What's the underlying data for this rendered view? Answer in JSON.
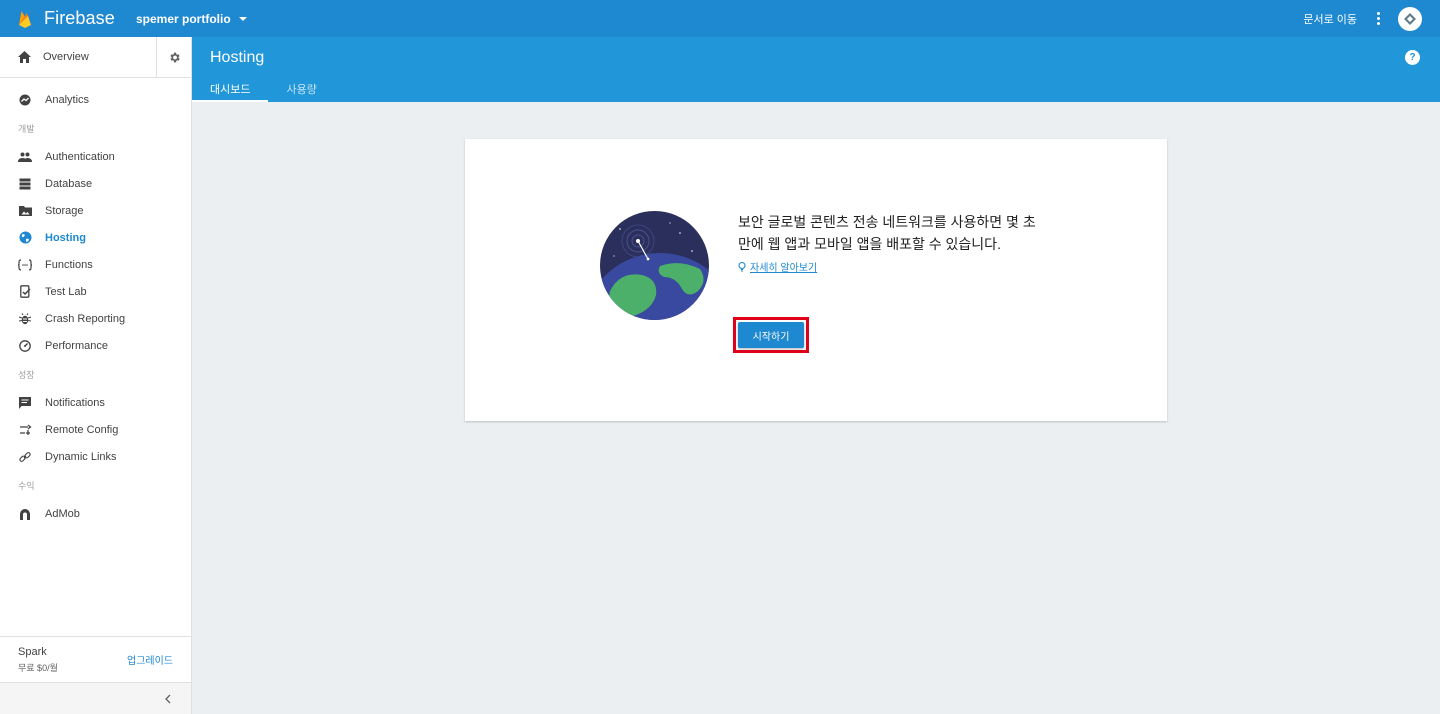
{
  "topbar": {
    "brand": "Firebase",
    "project": "spemer portfolio",
    "docs_link": "문서로 이동"
  },
  "sidebar": {
    "overview": "Overview",
    "items": [
      {
        "label": "Analytics",
        "icon": "analytics-icon"
      },
      {
        "section": "개발"
      },
      {
        "label": "Authentication",
        "icon": "people-icon"
      },
      {
        "label": "Database",
        "icon": "database-icon"
      },
      {
        "label": "Storage",
        "icon": "folder-image-icon"
      },
      {
        "label": "Hosting",
        "icon": "globe-icon",
        "active": true
      },
      {
        "label": "Functions",
        "icon": "functions-icon"
      },
      {
        "label": "Test Lab",
        "icon": "test-lab-icon"
      },
      {
        "label": "Crash Reporting",
        "icon": "bug-icon"
      },
      {
        "label": "Performance",
        "icon": "speedometer-icon"
      },
      {
        "section": "성장"
      },
      {
        "label": "Notifications",
        "icon": "message-icon"
      },
      {
        "label": "Remote Config",
        "icon": "remote-config-icon"
      },
      {
        "label": "Dynamic Links",
        "icon": "link-icon"
      },
      {
        "section": "수익"
      },
      {
        "label": "AdMob",
        "icon": "admob-icon"
      }
    ],
    "plan_name": "Spark",
    "plan_price": "무료 $0/월",
    "upgrade": "업그레이드"
  },
  "header": {
    "title": "Hosting",
    "tabs": [
      {
        "label": "대시보드",
        "active": true
      },
      {
        "label": "사용량",
        "active": false
      }
    ]
  },
  "card": {
    "description": "보안 글로벌 콘텐츠 전송 네트워크를 사용하면 몇 초 만에 웹 앱과 모바일 앱을 배포할 수 있습니다.",
    "learn_more": "자세히 알아보기",
    "cta": "시작하기"
  },
  "colors": {
    "topbar": "#1e88d0",
    "header": "#2196d8",
    "highlight": "#e0001a"
  }
}
